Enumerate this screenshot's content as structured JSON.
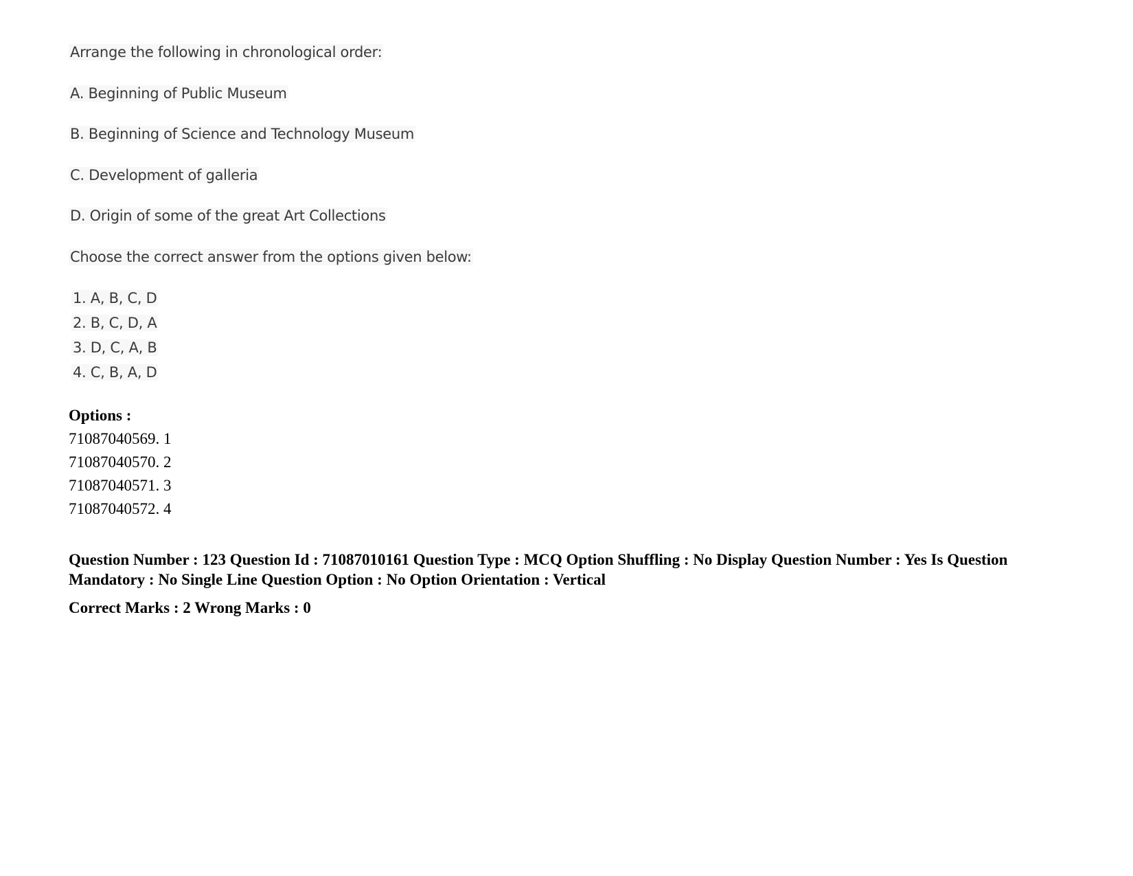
{
  "question": {
    "prompt": "Arrange the following in chronological order:",
    "statements": [
      "A. Beginning of Public Museum",
      "B. Beginning of Science and Technology Museum",
      "C. Development of galleria",
      "D. Origin of some of the great Art Collections"
    ],
    "instruction": "Choose the correct answer from the options given below:",
    "choices": [
      "1. A, B, C, D",
      "2. B, C, D, A",
      "3. D, C, A, B",
      "4. C, B, A, D"
    ]
  },
  "options": {
    "label": "Options :",
    "items": [
      "71087040569. 1",
      "71087040570. 2",
      "71087040571. 3",
      "71087040572. 4"
    ]
  },
  "next_question_meta": {
    "line1": "Question Number : 123 Question Id : 71087010161 Question Type : MCQ Option Shuffling : No Display Question Number : Yes Is Question Mandatory : No Single Line Question Option : No Option Orientation : Vertical",
    "marks": "Correct Marks : 2 Wrong Marks : 0"
  }
}
